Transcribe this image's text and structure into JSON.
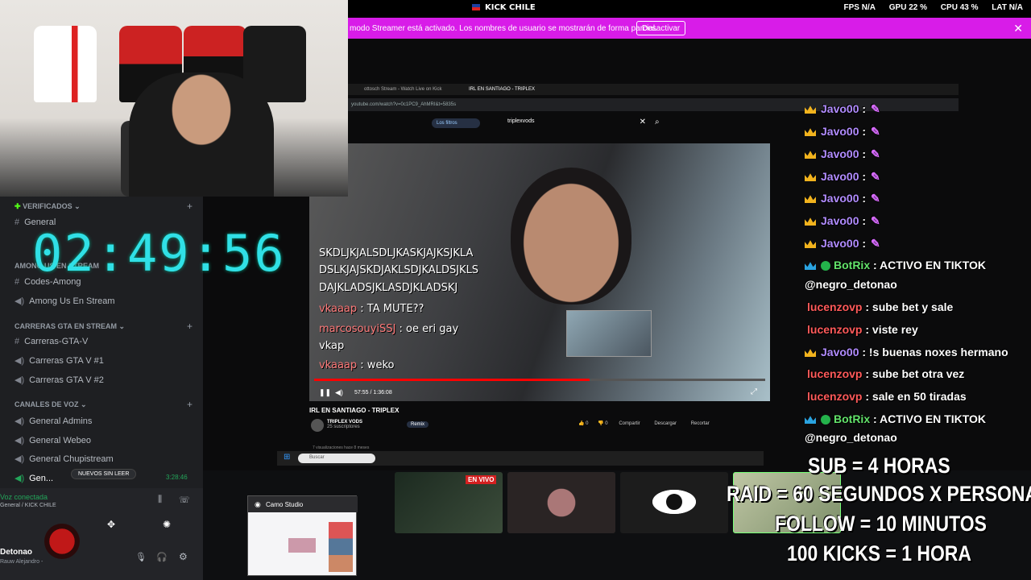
{
  "topbar": {
    "title": "KICK CHILE",
    "stats": [
      {
        "label": "FPS",
        "value": "N/A"
      },
      {
        "label": "GPU",
        "value": "22 %"
      },
      {
        "label": "CPU",
        "value": "43 %"
      },
      {
        "label": "LAT",
        "value": "N/A"
      }
    ]
  },
  "banner": {
    "text": "modo Streamer está activado. Los nombres de usuario se mostrarán de forma parcial.",
    "button": "Desactivar",
    "close": "✕"
  },
  "timer": "02:49:56",
  "discord": {
    "categories": [
      {
        "label": "VERIFICADOS",
        "channels": [
          {
            "type": "text",
            "name": "General"
          }
        ]
      },
      {
        "label": "AMONG US EN STREAM",
        "channels": [
          {
            "type": "text",
            "name": "Codes-Among"
          },
          {
            "type": "voice",
            "name": "Among Us En Stream"
          }
        ]
      },
      {
        "label": "CARRERAS GTA EN STREAM",
        "channels": [
          {
            "type": "text",
            "name": "Carreras-GTA-V"
          },
          {
            "type": "voice",
            "name": "Carreras GTA V #1"
          },
          {
            "type": "voice",
            "name": "Carreras GTA V #2"
          }
        ]
      },
      {
        "label": "CANALES DE VOZ",
        "channels": [
          {
            "type": "voice",
            "name": "General Admins"
          },
          {
            "type": "voice",
            "name": "General Webeo"
          },
          {
            "type": "voice",
            "name": "General Chupistream"
          },
          {
            "type": "voice",
            "name": "Gen..."
          }
        ]
      }
    ],
    "unread_pill": "NUEVOS SIN LEER",
    "voice_time": "3:28:46",
    "voice_status": "Voz conectada",
    "voice_channel": "General / KICK CHILE",
    "user_name": "Detonao",
    "user_status": "Rauw Alejandro -"
  },
  "browser": {
    "tabs": [
      "ottosch Stream - Watch Live on Kick",
      "IRL EN SANTIAGO - TRIPLEX"
    ],
    "url": "youtube.com/watch?v=0c1PC9_AhMRI&t=5835s",
    "filter": "Los filtros",
    "search": "triplexvods"
  },
  "video": {
    "chat": [
      {
        "user": "",
        "text": "SKDLJKJALSDLJKASKJAJKSJKLA"
      },
      {
        "user": "",
        "text": "DSLKJAJSKDJAKLSDJKALDSJKLS"
      },
      {
        "user": "",
        "text": "DAJKLADSJKLASDJKLADSKJ"
      },
      {
        "user": "vkaaap",
        "text": ": TA MUTE??"
      },
      {
        "user": "marcosouyiSSJ",
        "text": ": oe eri gay"
      },
      {
        "user": "",
        "text": "vkap"
      },
      {
        "user": "vkaaap",
        "text": ": weko"
      }
    ],
    "progress": 0.61,
    "time": "57:55 / 1:36:08",
    "title": "IRL EN SANTIAGO - TRIPLEX",
    "channel": "TRIPLEX VODS",
    "subs": "25 suscriptores",
    "actions": [
      "0",
      "0",
      "Compartir",
      "Descargar",
      "Recortar"
    ],
    "remix": "Remix",
    "views": "7 visualizaciones  hace 8 meses"
  },
  "overlay_chat": [
    {
      "kind": "javo",
      "user": "Javo00",
      "text": ":"
    },
    {
      "kind": "javo",
      "user": "Javo00",
      "text": ":"
    },
    {
      "kind": "javo",
      "user": "Javo00",
      "text": ":"
    },
    {
      "kind": "javo",
      "user": "Javo00",
      "text": ":"
    },
    {
      "kind": "javo",
      "user": "Javo00",
      "text": ":"
    },
    {
      "kind": "javo",
      "user": "Javo00",
      "text": ":"
    },
    {
      "kind": "javo",
      "user": "Javo00",
      "text": ":"
    },
    {
      "kind": "bot",
      "user": "BotRix",
      "text": ": ACTIVO EN TIKTOK"
    },
    {
      "kind": "plain",
      "user": "",
      "text": "@negro_detonao"
    },
    {
      "kind": "luc",
      "user": "lucenzovp",
      "text": ": sube bet y sale"
    },
    {
      "kind": "luc",
      "user": "lucenzovp",
      "text": ": viste rey"
    },
    {
      "kind": "javo",
      "user": "Javo00",
      "text": ": !s buenas noxes hermano"
    },
    {
      "kind": "luc",
      "user": "lucenzovp",
      "text": ": sube bet otra vez"
    },
    {
      "kind": "luc",
      "user": "lucenzovp",
      "text": ": sale en 50 tiradas"
    },
    {
      "kind": "bot",
      "user": "BotRix",
      "text": ": ACTIVO EN TIKTOK"
    },
    {
      "kind": "plain",
      "user": "",
      "text": "@negro_detonao"
    }
  ],
  "rules": [
    "SUB = 4 HORAS",
    "RAID = 60 SEGUNDOS X PERSONA",
    "FOLLOW = 10 MINUTOS",
    "100 KICKS = 1 HORA"
  ],
  "camo": {
    "title": "Camo Studio"
  },
  "thumbnails": {
    "live_badge": "EN VIVO"
  },
  "taskbar": {
    "search": "Buscar"
  },
  "colors": {
    "kick_green": "#53fc18",
    "banner": "#d81ce8",
    "timer": "#30e0e6"
  }
}
